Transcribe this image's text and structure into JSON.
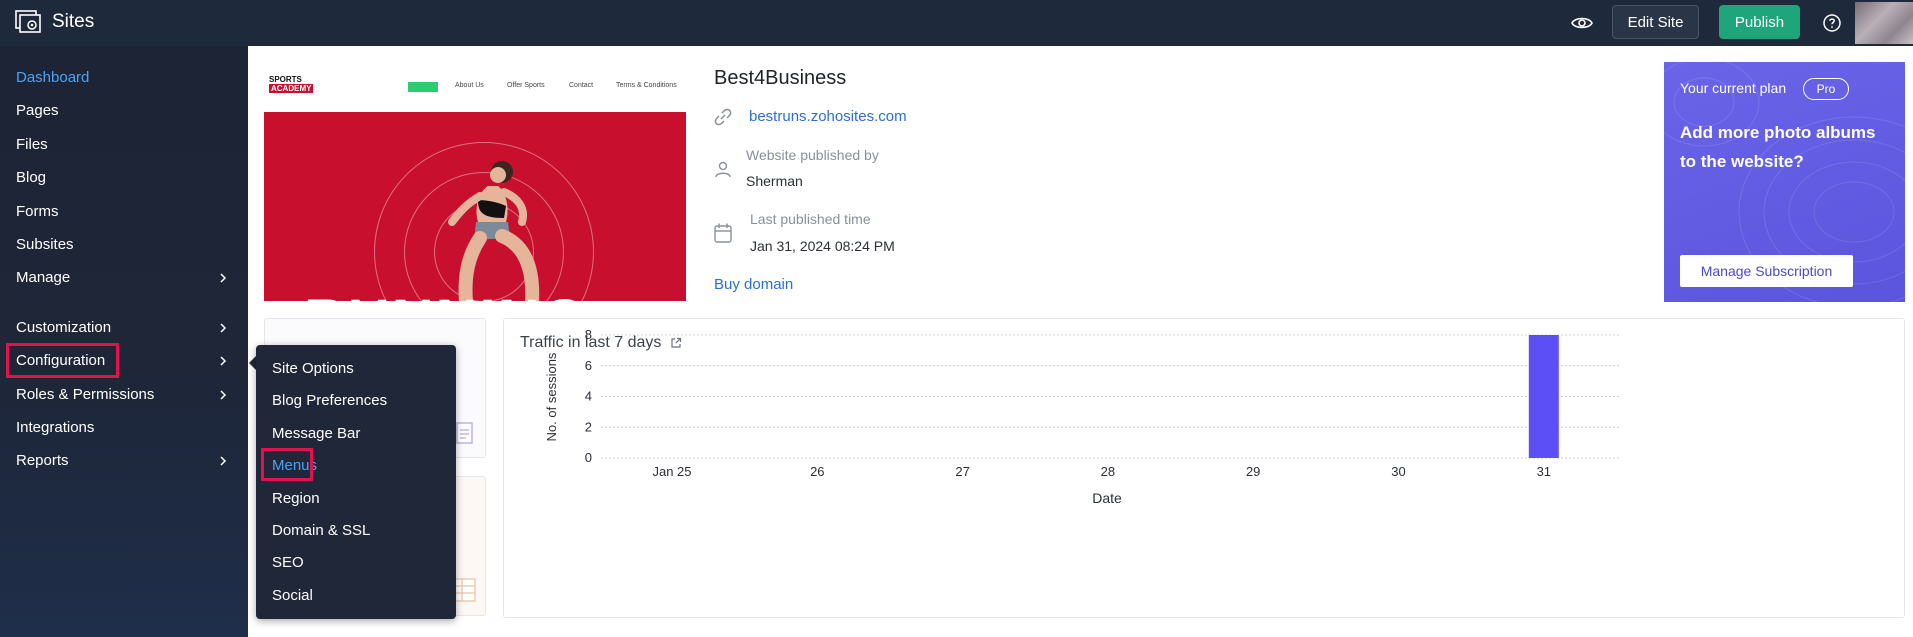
{
  "app": {
    "title": "Sites"
  },
  "topbar": {
    "edit_site": "Edit Site",
    "publish": "Publish"
  },
  "sidebar": {
    "items": [
      {
        "label": "Dashboard",
        "active": true
      },
      {
        "label": "Pages"
      },
      {
        "label": "Files"
      },
      {
        "label": "Blog"
      },
      {
        "label": "Forms"
      },
      {
        "label": "Subsites"
      },
      {
        "label": "Manage",
        "has_submenu": true
      },
      {
        "label": "Customization",
        "has_submenu": true
      },
      {
        "label": "Configuration",
        "has_submenu": true,
        "highlighted": true
      },
      {
        "label": "Roles & Permissions",
        "has_submenu": true
      },
      {
        "label": "Integrations"
      },
      {
        "label": "Reports",
        "has_submenu": true
      }
    ]
  },
  "config_menu": {
    "items": [
      {
        "label": "Site Options"
      },
      {
        "label": "Blog Preferences"
      },
      {
        "label": "Message Bar"
      },
      {
        "label": "Menus",
        "active": true,
        "highlighted": true
      },
      {
        "label": "Region"
      },
      {
        "label": "Domain & SSL"
      },
      {
        "label": "SEO"
      },
      {
        "label": "Social"
      }
    ]
  },
  "thumbnail": {
    "logo_top": "SPORTS",
    "logo_bottom": "ACADEMY",
    "nav": [
      "About Us",
      "Offer Sports",
      "Contact",
      "Terms & Conditions"
    ],
    "hero_text": "RUNNING"
  },
  "site": {
    "name": "Best4Business",
    "url": "bestruns.zohosites.com",
    "published_by_label": "Website published by",
    "published_by": "Sherman",
    "published_time_label": "Last published time",
    "published_time": "Jan 31, 2024 08:24 PM",
    "buy_domain": "Buy domain"
  },
  "plan": {
    "label": "Your current plan",
    "badge": "Pro",
    "promo": "Add more photo albums to the website?",
    "button": "Manage Subscription",
    "colors": {
      "background": "#5f59e2"
    }
  },
  "traffic": {
    "title": "Traffic in last 7 days"
  },
  "chart_data": {
    "type": "bar",
    "title": "Traffic in last 7 days",
    "categories": [
      "Jan 25",
      "26",
      "27",
      "28",
      "29",
      "30",
      "31"
    ],
    "values": [
      0,
      0,
      0,
      0,
      0,
      0,
      8
    ],
    "xlabel": "Date",
    "ylabel": "No. of sessions",
    "yticks": [
      0,
      2,
      4,
      6,
      8
    ],
    "ylim": [
      0,
      8
    ],
    "grid": true,
    "bar_color": "#5b4ff5"
  }
}
